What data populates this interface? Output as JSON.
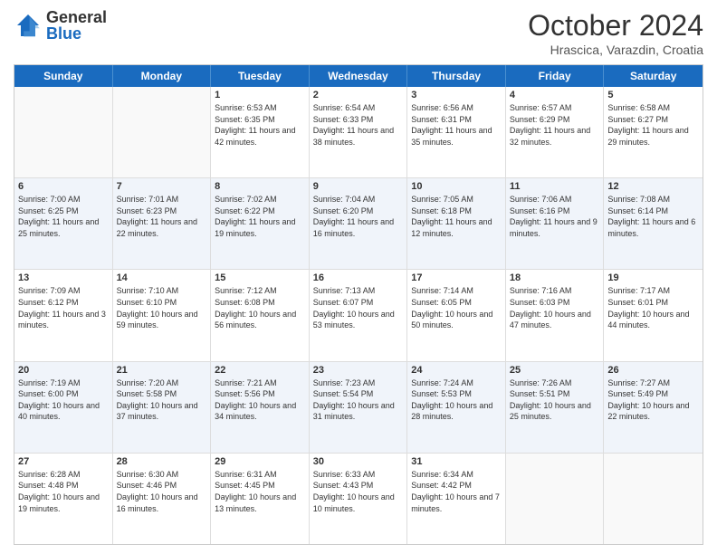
{
  "header": {
    "logo": {
      "general": "General",
      "blue": "Blue"
    },
    "title": "October 2024",
    "subtitle": "Hrascica, Varazdin, Croatia"
  },
  "calendar": {
    "days": [
      "Sunday",
      "Monday",
      "Tuesday",
      "Wednesday",
      "Thursday",
      "Friday",
      "Saturday"
    ],
    "rows": [
      [
        {
          "day": "",
          "info": ""
        },
        {
          "day": "",
          "info": ""
        },
        {
          "day": "1",
          "info": "Sunrise: 6:53 AM\nSunset: 6:35 PM\nDaylight: 11 hours and 42 minutes."
        },
        {
          "day": "2",
          "info": "Sunrise: 6:54 AM\nSunset: 6:33 PM\nDaylight: 11 hours and 38 minutes."
        },
        {
          "day": "3",
          "info": "Sunrise: 6:56 AM\nSunset: 6:31 PM\nDaylight: 11 hours and 35 minutes."
        },
        {
          "day": "4",
          "info": "Sunrise: 6:57 AM\nSunset: 6:29 PM\nDaylight: 11 hours and 32 minutes."
        },
        {
          "day": "5",
          "info": "Sunrise: 6:58 AM\nSunset: 6:27 PM\nDaylight: 11 hours and 29 minutes."
        }
      ],
      [
        {
          "day": "6",
          "info": "Sunrise: 7:00 AM\nSunset: 6:25 PM\nDaylight: 11 hours and 25 minutes."
        },
        {
          "day": "7",
          "info": "Sunrise: 7:01 AM\nSunset: 6:23 PM\nDaylight: 11 hours and 22 minutes."
        },
        {
          "day": "8",
          "info": "Sunrise: 7:02 AM\nSunset: 6:22 PM\nDaylight: 11 hours and 19 minutes."
        },
        {
          "day": "9",
          "info": "Sunrise: 7:04 AM\nSunset: 6:20 PM\nDaylight: 11 hours and 16 minutes."
        },
        {
          "day": "10",
          "info": "Sunrise: 7:05 AM\nSunset: 6:18 PM\nDaylight: 11 hours and 12 minutes."
        },
        {
          "day": "11",
          "info": "Sunrise: 7:06 AM\nSunset: 6:16 PM\nDaylight: 11 hours and 9 minutes."
        },
        {
          "day": "12",
          "info": "Sunrise: 7:08 AM\nSunset: 6:14 PM\nDaylight: 11 hours and 6 minutes."
        }
      ],
      [
        {
          "day": "13",
          "info": "Sunrise: 7:09 AM\nSunset: 6:12 PM\nDaylight: 11 hours and 3 minutes."
        },
        {
          "day": "14",
          "info": "Sunrise: 7:10 AM\nSunset: 6:10 PM\nDaylight: 10 hours and 59 minutes."
        },
        {
          "day": "15",
          "info": "Sunrise: 7:12 AM\nSunset: 6:08 PM\nDaylight: 10 hours and 56 minutes."
        },
        {
          "day": "16",
          "info": "Sunrise: 7:13 AM\nSunset: 6:07 PM\nDaylight: 10 hours and 53 minutes."
        },
        {
          "day": "17",
          "info": "Sunrise: 7:14 AM\nSunset: 6:05 PM\nDaylight: 10 hours and 50 minutes."
        },
        {
          "day": "18",
          "info": "Sunrise: 7:16 AM\nSunset: 6:03 PM\nDaylight: 10 hours and 47 minutes."
        },
        {
          "day": "19",
          "info": "Sunrise: 7:17 AM\nSunset: 6:01 PM\nDaylight: 10 hours and 44 minutes."
        }
      ],
      [
        {
          "day": "20",
          "info": "Sunrise: 7:19 AM\nSunset: 6:00 PM\nDaylight: 10 hours and 40 minutes."
        },
        {
          "day": "21",
          "info": "Sunrise: 7:20 AM\nSunset: 5:58 PM\nDaylight: 10 hours and 37 minutes."
        },
        {
          "day": "22",
          "info": "Sunrise: 7:21 AM\nSunset: 5:56 PM\nDaylight: 10 hours and 34 minutes."
        },
        {
          "day": "23",
          "info": "Sunrise: 7:23 AM\nSunset: 5:54 PM\nDaylight: 10 hours and 31 minutes."
        },
        {
          "day": "24",
          "info": "Sunrise: 7:24 AM\nSunset: 5:53 PM\nDaylight: 10 hours and 28 minutes."
        },
        {
          "day": "25",
          "info": "Sunrise: 7:26 AM\nSunset: 5:51 PM\nDaylight: 10 hours and 25 minutes."
        },
        {
          "day": "26",
          "info": "Sunrise: 7:27 AM\nSunset: 5:49 PM\nDaylight: 10 hours and 22 minutes."
        }
      ],
      [
        {
          "day": "27",
          "info": "Sunrise: 6:28 AM\nSunset: 4:48 PM\nDaylight: 10 hours and 19 minutes."
        },
        {
          "day": "28",
          "info": "Sunrise: 6:30 AM\nSunset: 4:46 PM\nDaylight: 10 hours and 16 minutes."
        },
        {
          "day": "29",
          "info": "Sunrise: 6:31 AM\nSunset: 4:45 PM\nDaylight: 10 hours and 13 minutes."
        },
        {
          "day": "30",
          "info": "Sunrise: 6:33 AM\nSunset: 4:43 PM\nDaylight: 10 hours and 10 minutes."
        },
        {
          "day": "31",
          "info": "Sunrise: 6:34 AM\nSunset: 4:42 PM\nDaylight: 10 hours and 7 minutes."
        },
        {
          "day": "",
          "info": ""
        },
        {
          "day": "",
          "info": ""
        }
      ]
    ]
  }
}
